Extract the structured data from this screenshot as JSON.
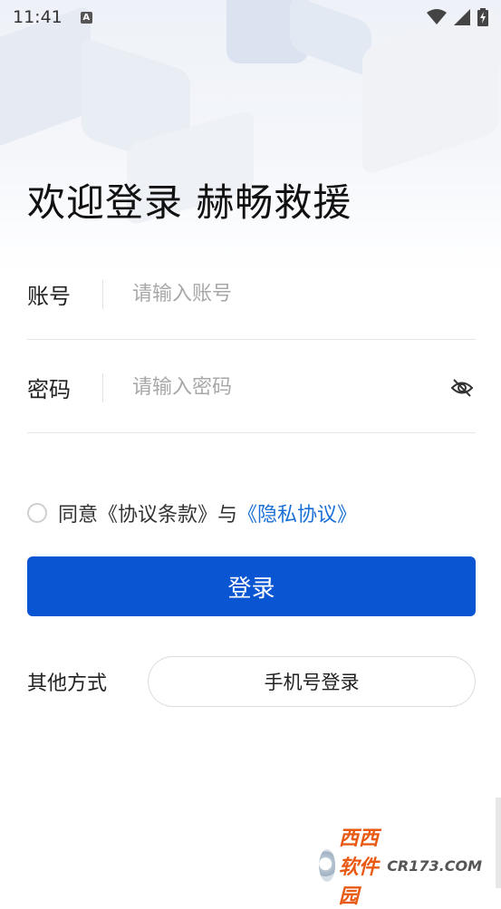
{
  "status_bar": {
    "time": "11:41",
    "notification_icon": "a-icon",
    "wifi_icon": "wifi-icon",
    "signal_icon": "signal-icon",
    "battery_icon": "battery-charging-icon"
  },
  "title": "欢迎登录 赫畅救援",
  "account": {
    "label": "账号",
    "placeholder": "请输入账号",
    "value": ""
  },
  "password": {
    "label": "密码",
    "placeholder": "请输入密码",
    "value": "",
    "toggle_icon": "eye-off-icon"
  },
  "agreement": {
    "checked": false,
    "prefix": "同意",
    "terms": "《协议条款》",
    "joiner": "与",
    "privacy": "《隐私协议》"
  },
  "login_button": "登录",
  "other": {
    "label": "其他方式",
    "phone_login": "手机号登录"
  },
  "watermark": {
    "brand": "西西软件园",
    "site": "CR173.COM"
  },
  "colors": {
    "primary": "#0a55d2",
    "link": "#1a6fd6"
  }
}
